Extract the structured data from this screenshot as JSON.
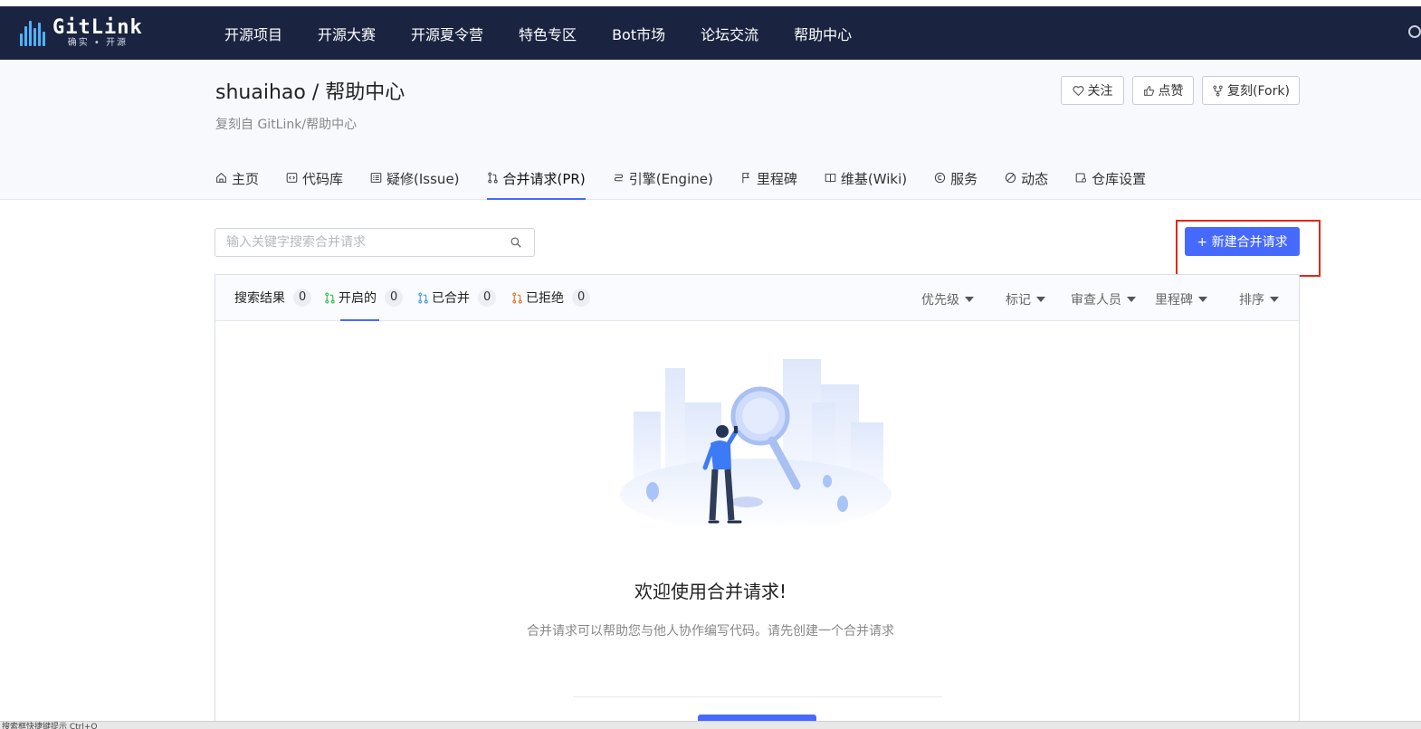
{
  "brand": {
    "name": "GitLink",
    "slogan": "确实 • 开源"
  },
  "nav": [
    "开源项目",
    "开源大赛",
    "开源夏令营",
    "特色专区",
    "Bot市场",
    "论坛交流",
    "帮助中心"
  ],
  "repo": {
    "title": "shuaihao / 帮助中心",
    "forked_from": "复刻自 GitLink/帮助中心"
  },
  "actions": {
    "watch": "关注",
    "star": "点赞",
    "fork": "复刻(Fork)"
  },
  "tabs": [
    {
      "label": "主页",
      "icon": "home-icon"
    },
    {
      "label": "代码库",
      "icon": "code-icon"
    },
    {
      "label": "疑修(Issue)",
      "icon": "issue-icon"
    },
    {
      "label": "合并请求(PR)",
      "icon": "pull-request-icon",
      "active": true
    },
    {
      "label": "引擎(Engine)",
      "icon": "engine-icon"
    },
    {
      "label": "里程碑",
      "icon": "flag-icon"
    },
    {
      "label": "维基(Wiki)",
      "icon": "book-icon"
    },
    {
      "label": "服务",
      "icon": "service-icon"
    },
    {
      "label": "动态",
      "icon": "activity-icon"
    },
    {
      "label": "仓库设置",
      "icon": "settings-icon"
    }
  ],
  "search": {
    "placeholder": "输入关键字搜索合并请求"
  },
  "new_pr_button": "+ 新建合并请求",
  "filter_tabs": [
    {
      "label": "搜索结果",
      "count": "0"
    },
    {
      "label": "开启的",
      "count": "0",
      "icon_color": "#2fb344"
    },
    {
      "label": "已合并",
      "count": "0",
      "icon_color": "#3f8ee8"
    },
    {
      "label": "已拒绝",
      "count": "0",
      "icon_color": "#e56a1e"
    }
  ],
  "filters": [
    "优先级",
    "标记",
    "审查人员",
    "里程碑",
    "排序"
  ],
  "empty": {
    "title": "欢迎使用合并请求!",
    "description": "合并请求可以帮助您与他人协作编写代码。请先创建一个合并请求"
  },
  "status_text": "搜索框快捷键提示 Ctrl+O",
  "colors": {
    "header": "#1a2441",
    "accent": "#466aff",
    "highlight": "#e5261a"
  }
}
